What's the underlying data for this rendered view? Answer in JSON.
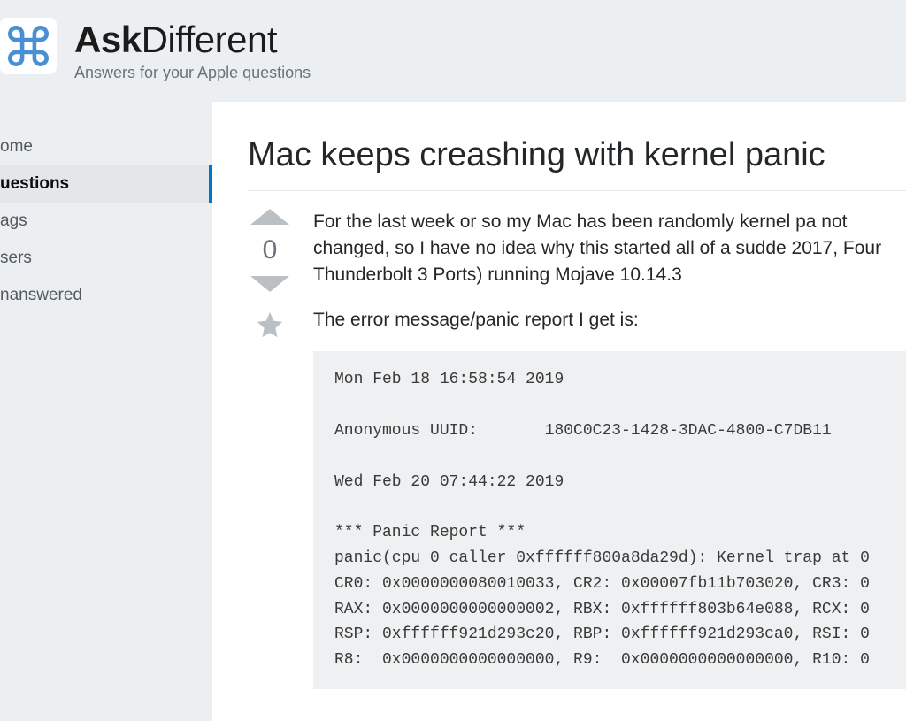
{
  "site": {
    "name_bold": "Ask",
    "name_light": "Different",
    "tagline": "Answers for your Apple questions"
  },
  "sidebar": {
    "items": [
      {
        "label": "ome"
      },
      {
        "label": "uestions"
      },
      {
        "label": "ags"
      },
      {
        "label": "sers"
      },
      {
        "label": "nanswered"
      }
    ]
  },
  "question": {
    "title": "Mac keeps creashing with kernel panic",
    "vote_count": "0",
    "body_p1": "For the last week or so my Mac has been randomly kernel pa not changed, so I have no idea why this started all of a sudde 2017, Four Thunderbolt 3 Ports) running Mojave 10.14.3",
    "body_p2": "The error message/panic report I get is:",
    "code": "Mon Feb 18 16:58:54 2019\n\nAnonymous UUID:       180C0C23-1428-3DAC-4800-C7DB11\n\nWed Feb 20 07:44:22 2019\n\n*** Panic Report ***\npanic(cpu 0 caller 0xffffff800a8da29d): Kernel trap at 0\nCR0: 0x0000000080010033, CR2: 0x00007fb11b703020, CR3: 0\nRAX: 0x0000000000000002, RBX: 0xffffff803b64e088, RCX: 0\nRSP: 0xffffff921d293c20, RBP: 0xffffff921d293ca0, RSI: 0\nR8:  0x0000000000000000, R9:  0x0000000000000000, R10: 0"
  }
}
